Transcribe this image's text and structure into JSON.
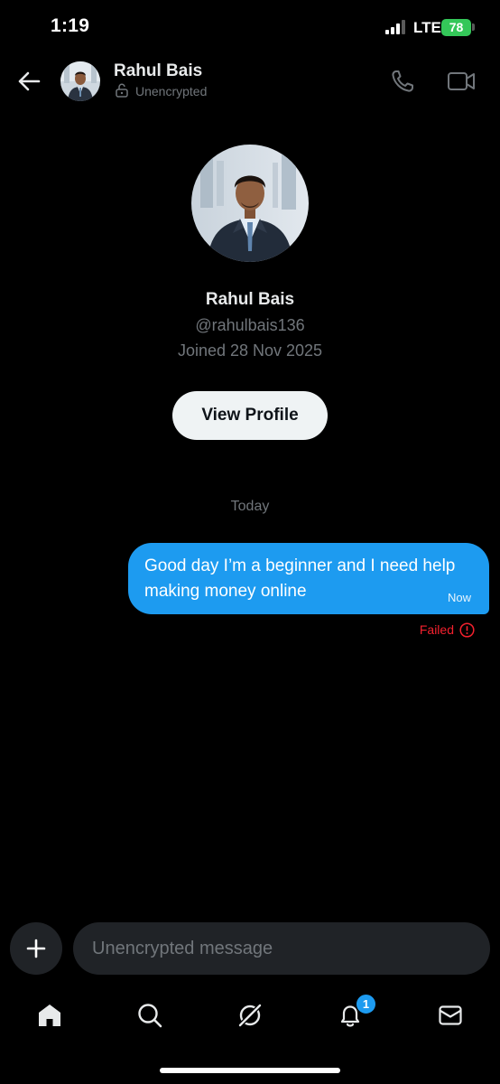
{
  "status_bar": {
    "time": "1:19",
    "network": "LTE",
    "battery_level": "78",
    "battery_color": "#34c759"
  },
  "header": {
    "back_icon": "arrow-left-icon",
    "contact_name": "Rahul Bais",
    "encryption_status": "Unencrypted",
    "lock_icon": "unlock-icon",
    "call_icon": "phone-icon",
    "video_icon": "video-camera-icon"
  },
  "profile": {
    "name": "Rahul Bais",
    "handle": "@rahulbais136",
    "joined": "Joined 28 Nov 2025",
    "view_profile_label": "View Profile"
  },
  "conversation": {
    "date_divider": "Today",
    "messages": [
      {
        "text": "Good day I’m a beginner and I need help making money online",
        "time": "Now",
        "status": "Failed",
        "bubble_color": "#1d9bf0",
        "status_color": "#f4212e"
      }
    ]
  },
  "composer": {
    "add_icon": "plus-icon",
    "placeholder": "Unencrypted message"
  },
  "bottom_nav": {
    "items": [
      {
        "icon": "home-icon"
      },
      {
        "icon": "search-icon"
      },
      {
        "icon": "grok-icon"
      },
      {
        "icon": "bell-icon",
        "badge": "1"
      },
      {
        "icon": "mail-icon"
      }
    ]
  },
  "colors": {
    "accent": "#1d9bf0",
    "background": "#000000",
    "secondary_text": "#71767b"
  }
}
